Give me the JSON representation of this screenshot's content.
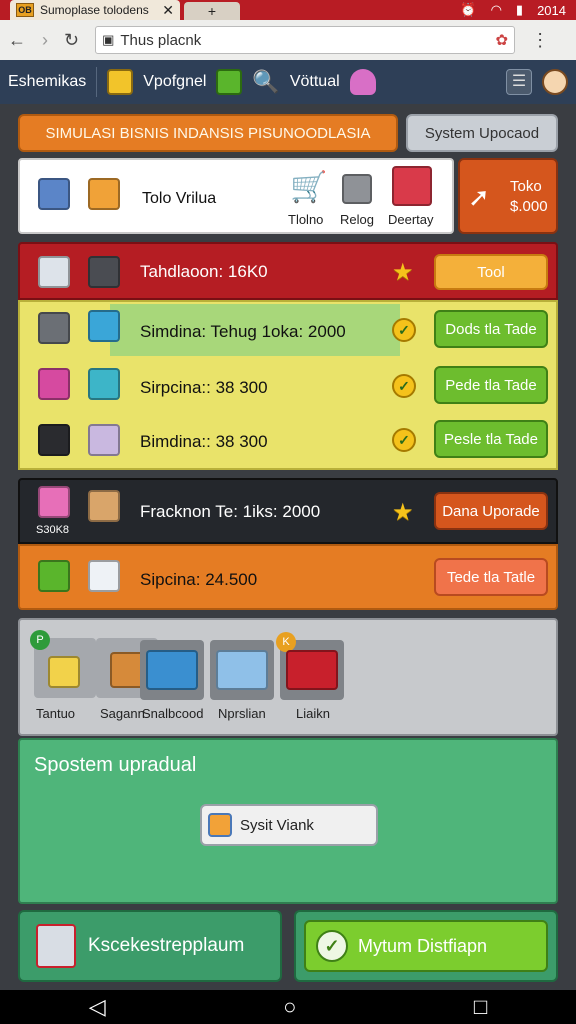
{
  "browser": {
    "tab_title": "Sumoplase tolodens",
    "tab_favicon": "OB",
    "new_tab": "+",
    "clock": "2014",
    "url": "Thus placnk"
  },
  "gamebar": {
    "label1": "Eshemikas",
    "label2": "Vpofgnel",
    "label3": "Vöttual"
  },
  "header": {
    "title": "SIMULASI BISNIS  INDANSIS PISUNOODLASIA",
    "system_button": "System Upocaod"
  },
  "toko_panel": {
    "name": "Tolo Vrilua",
    "items": [
      "Tlolno",
      "Relog",
      "Deertay"
    ],
    "action_line1": "Toko",
    "action_line2": "$.000"
  },
  "rows": [
    {
      "text": "Tahdlaoon: 16K0",
      "button": "Tool",
      "mark": "star"
    },
    {
      "text": "Simdina: Tehug  1oka: 2000",
      "button": "Dods tla Tade",
      "mark": "check"
    },
    {
      "text": "Sirpcina:: 38 300",
      "button": "Pede tla Tade",
      "mark": "check"
    },
    {
      "text": "Bimdina:: 38 300",
      "button": "Pesle tla Tade",
      "mark": "check"
    },
    {
      "text": "Fracknon  Te:  1iks: 2000",
      "button": "Dana Uporade",
      "mark": "star",
      "badge": "S30K8"
    },
    {
      "text": "Sipcina:  24.500",
      "button": "Tede tla Tatle"
    }
  ],
  "buildings": {
    "items": [
      {
        "label": "Tantuo",
        "badge": "P"
      },
      {
        "label": "Sagann"
      },
      {
        "label": "Snalbcood"
      },
      {
        "label": "Nprslian"
      },
      {
        "label": "Liaikn",
        "badge": "K"
      }
    ]
  },
  "upgrade_panel": {
    "title": "Spostem upradual",
    "button": "Sysit Viank"
  },
  "bottom_buttons": {
    "left": "Kscekestrepplaum",
    "right": "Mytum Distfiapn"
  },
  "colors": {
    "status_red": "#b81c24",
    "orange": "#e57c23",
    "green": "#4caf50",
    "panel_green": "#4fb57a"
  }
}
